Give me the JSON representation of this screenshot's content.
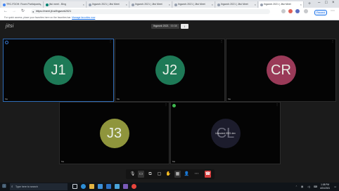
{
  "browser": {
    "tabs": [
      {
        "label": "TRC-FDOH: Room Participants"
      },
      {
        "label": "jitsi meet - Bing"
      },
      {
        "label": "Ihgwork 2021 | Jitsi Meet"
      },
      {
        "label": "Ihgwork 2021 | Jitsi Meet"
      },
      {
        "label": "Ihgwork 2021 | Jitsi Meet"
      },
      {
        "label": "Ihgwork 2021 | Jitsi Meet"
      },
      {
        "label": "Ihgwork 2021 | Jitsi Meet"
      }
    ],
    "address": "https://meet.jit.si/Ihgwork2021",
    "paused_label": "Paused",
    "bookmarks_text": "For quick access, place your favorites here on the favorites bar.",
    "bookmarks_link": "Manage favorites now"
  },
  "meeting": {
    "logo": "jitsi",
    "room_name": "Ihgwork 2021",
    "timer": "00:38",
    "info_icon": "i",
    "tiles": [
      {
        "initials": "J1",
        "color": "#1e7a57",
        "name": "Me",
        "dominant": true
      },
      {
        "initials": "J2",
        "color": "#1e7a57",
        "name": "Me"
      },
      {
        "initials": "CR",
        "color": "#9a3a58",
        "name": "Me"
      },
      {
        "initials": "J3",
        "color": "#8f953c",
        "name": "Me"
      },
      {
        "initials": "CL",
        "color": "#1c1c2c",
        "name": "Me",
        "overlay": "Unmuted 2021 dev",
        "dominant": true
      }
    ],
    "toolbar_icons": [
      "microphone-icon",
      "camera-icon",
      "share-screen-icon",
      "chat-icon",
      "raise-hand-icon",
      "tile-view-icon",
      "participants-icon",
      "more-icon",
      "hangup-icon"
    ]
  },
  "taskbar": {
    "search_placeholder": "Type here to search",
    "time": "1:08 PM",
    "date": "4/21/2021"
  }
}
